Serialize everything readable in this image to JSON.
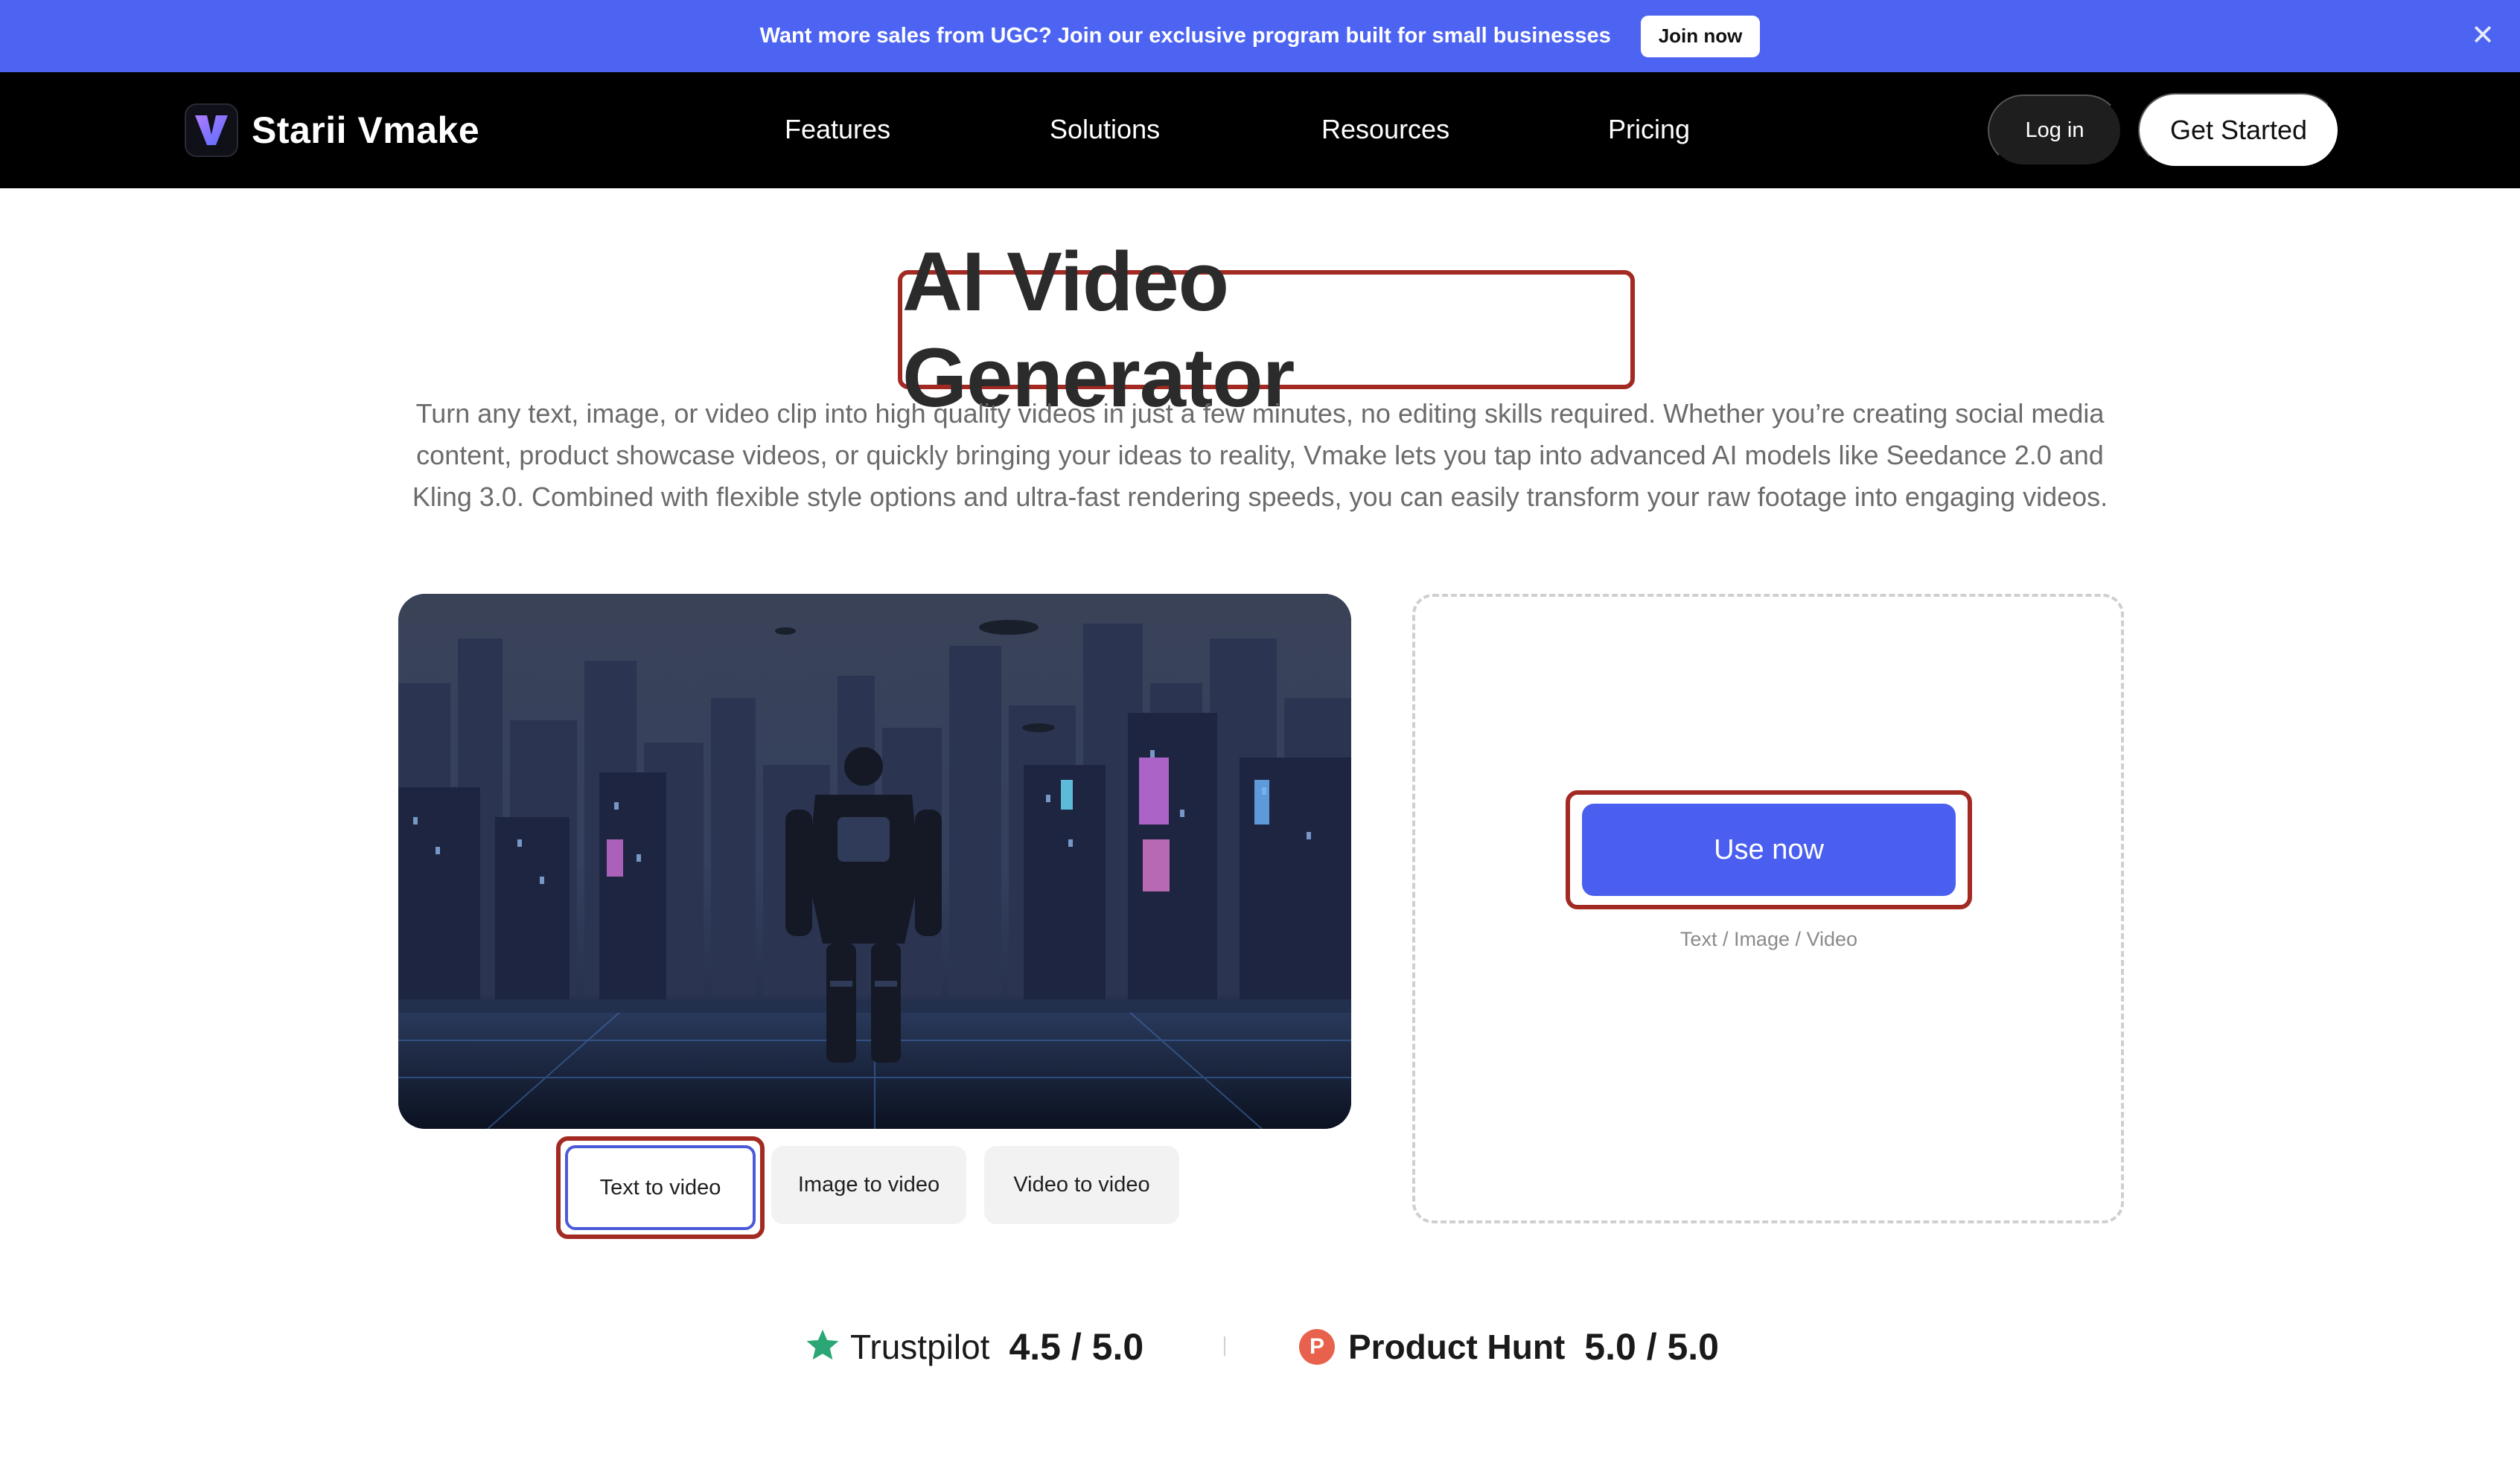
{
  "banner": {
    "text": "Want more sales from UGC? Join our exclusive program built for small businesses",
    "cta": "Join now",
    "close_icon": "close-icon"
  },
  "nav": {
    "brand": "Starii Vmake",
    "links": [
      "Features",
      "Solutions",
      "Resources",
      "Pricing"
    ],
    "login": "Log in",
    "get_started": "Get Started"
  },
  "hero": {
    "title": "AI Video Generator",
    "description": "Turn any text, image, or video clip into high quality videos in just a few minutes, no editing skills required. Whether you’re creating social media content, product showcase videos, or quickly bringing your ideas to reality, Vmake lets you tap into advanced AI models like Seedance 2.0 and Kling 3.0. Combined with flexible style options and ultra-fast rendering speeds, you can easily transform your raw footage into engaging videos."
  },
  "modes": {
    "tabs": [
      "Text to video",
      "Image to video",
      "Video to video"
    ],
    "active": "Text to video"
  },
  "panel": {
    "use_now": "Use now",
    "supported": "Text / Image / Video"
  },
  "ratings": [
    {
      "name": "Trustpilot",
      "score": "4.5 / 5.0",
      "icon": "star-icon",
      "color": "#2aa774"
    },
    {
      "name": "Product Hunt",
      "score": "5.0 / 5.0",
      "icon": "product-hunt-icon",
      "color": "#e8614c",
      "badge": "P"
    }
  ],
  "colors": {
    "accent": "#4d64f2",
    "highlight_outline": "#a32a22"
  }
}
